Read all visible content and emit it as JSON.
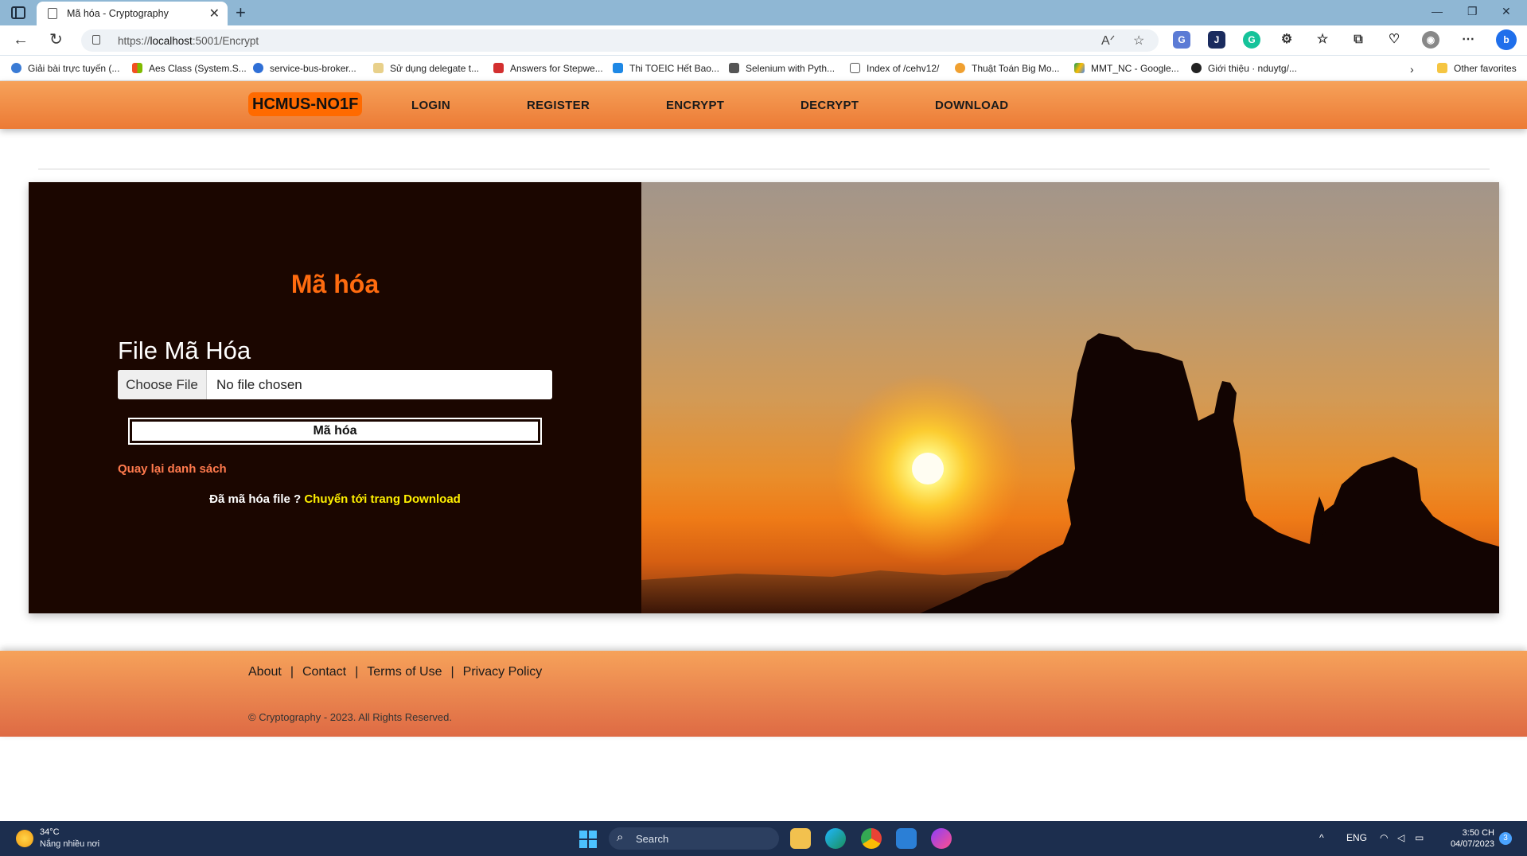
{
  "browser": {
    "tab_title": "Mã hóa - Cryptography",
    "url_prefix": "https://",
    "url_host": "localhost",
    "url_rest": ":5001/Encrypt",
    "bookmarks": [
      "Giải bài trực tuyến (...",
      "Aes Class (System.S...",
      "service-bus-broker...",
      "Sử dụng delegate t...",
      "Answers for Stepwe...",
      "Thi TOEIC Hết Bao...",
      "Selenium with Pyth...",
      "Index of /cehv12/",
      "Thuật Toán Big Mo...",
      "MMT_NC - Google...",
      "Giới thiệu · nduytg/..."
    ],
    "other_favorites": "Other favorites"
  },
  "header": {
    "brand": "HCMUS-NO1F",
    "nav": [
      "LOGIN",
      "REGISTER",
      "ENCRYPT",
      "DECRYPT",
      "DOWNLOAD"
    ]
  },
  "form": {
    "title": "Mã hóa",
    "field_label": "File Mã Hóa",
    "file_button": "Choose File",
    "file_status": "No file chosen",
    "submit_label": "Mã hóa",
    "back_link": "Quay lại danh sách",
    "hint_text": "Đã mã hóa file ? ",
    "hint_link": "Chuyển tới trang Download"
  },
  "footer": {
    "links": [
      "About",
      "Contact",
      "Terms of Use",
      "Privacy Policy"
    ],
    "copyright": "© Cryptography - 2023. All Rights Reserved."
  },
  "taskbar": {
    "temperature": "34°C",
    "weather": "Nắng nhiều nơi",
    "search_placeholder": "Search",
    "language": "ENG",
    "time": "3:50 CH",
    "date": "04/07/2023",
    "notifications": "3"
  },
  "colors": {
    "header_orange": "#f6a25a",
    "brand_bg": "#ff6a00",
    "panel_bg": "#1b0600",
    "title_orange": "#ff6b0f",
    "back_link": "#ff7a4d",
    "hint_link": "#fff000"
  }
}
